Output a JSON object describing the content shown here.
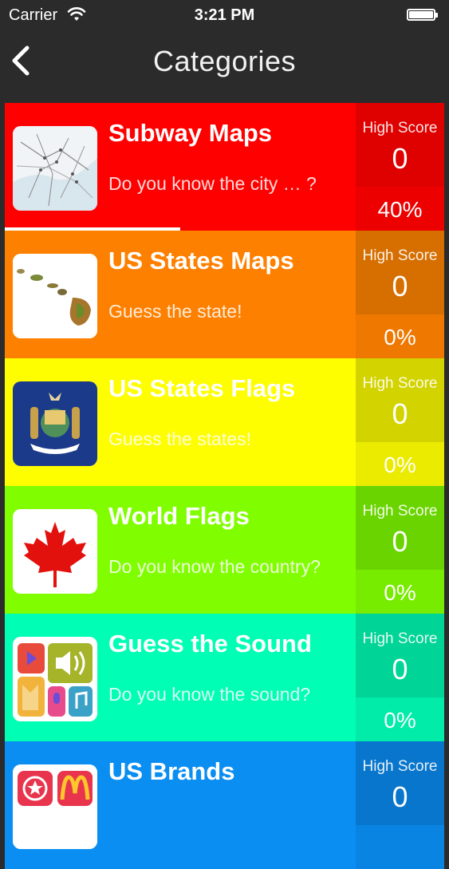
{
  "status_bar": {
    "carrier": "Carrier",
    "time": "3:21 PM"
  },
  "nav": {
    "title": "Categories"
  },
  "categories": [
    {
      "name": "Subway Maps",
      "subtitle": "Do you know the city … ?",
      "high_score_label": "High Score",
      "high_score": "0",
      "progress": "40%",
      "progress_fraction": 0.4,
      "color": "#fe0000",
      "score_color": "#df0000",
      "pct_color": "#ed0000",
      "thumb_icon": "subway-map-icon"
    },
    {
      "name": "US States Maps",
      "subtitle": "Guess the state!",
      "high_score_label": "High Score",
      "high_score": "0",
      "progress": "0%",
      "progress_fraction": 0,
      "color": "#fe8000",
      "score_color": "#d66e00",
      "pct_color": "#ee7800",
      "thumb_icon": "hawaii-map-icon"
    },
    {
      "name": "US States Flags",
      "subtitle": "Guess the states!",
      "high_score_label": "High Score",
      "high_score": "0",
      "progress": "0%",
      "progress_fraction": 0,
      "color": "#fefe00",
      "score_color": "#d3d300",
      "pct_color": "#ebeb00",
      "thumb_icon": "state-flag-icon"
    },
    {
      "name": "World Flags",
      "subtitle": "Do you know the country?",
      "high_score_label": "High Score",
      "high_score": "0",
      "progress": "0%",
      "progress_fraction": 0,
      "color": "#80fe00",
      "score_color": "#6ad400",
      "pct_color": "#77ec00",
      "thumb_icon": "canada-flag-icon"
    },
    {
      "name": "Guess the Sound",
      "subtitle": "Do you know the sound?",
      "high_score_label": "High Score",
      "high_score": "0",
      "progress": "0%",
      "progress_fraction": 0,
      "color": "#00feb4",
      "score_color": "#00d496",
      "pct_color": "#00eca8",
      "thumb_icon": "sound-apps-icon"
    },
    {
      "name": "US Brands",
      "subtitle": "",
      "high_score_label": "High Score",
      "high_score": "0",
      "progress": "",
      "progress_fraction": 0,
      "color": "#0a8ef2",
      "score_color": "#0876cc",
      "pct_color": "#0984e2",
      "thumb_icon": "brands-icon"
    }
  ]
}
